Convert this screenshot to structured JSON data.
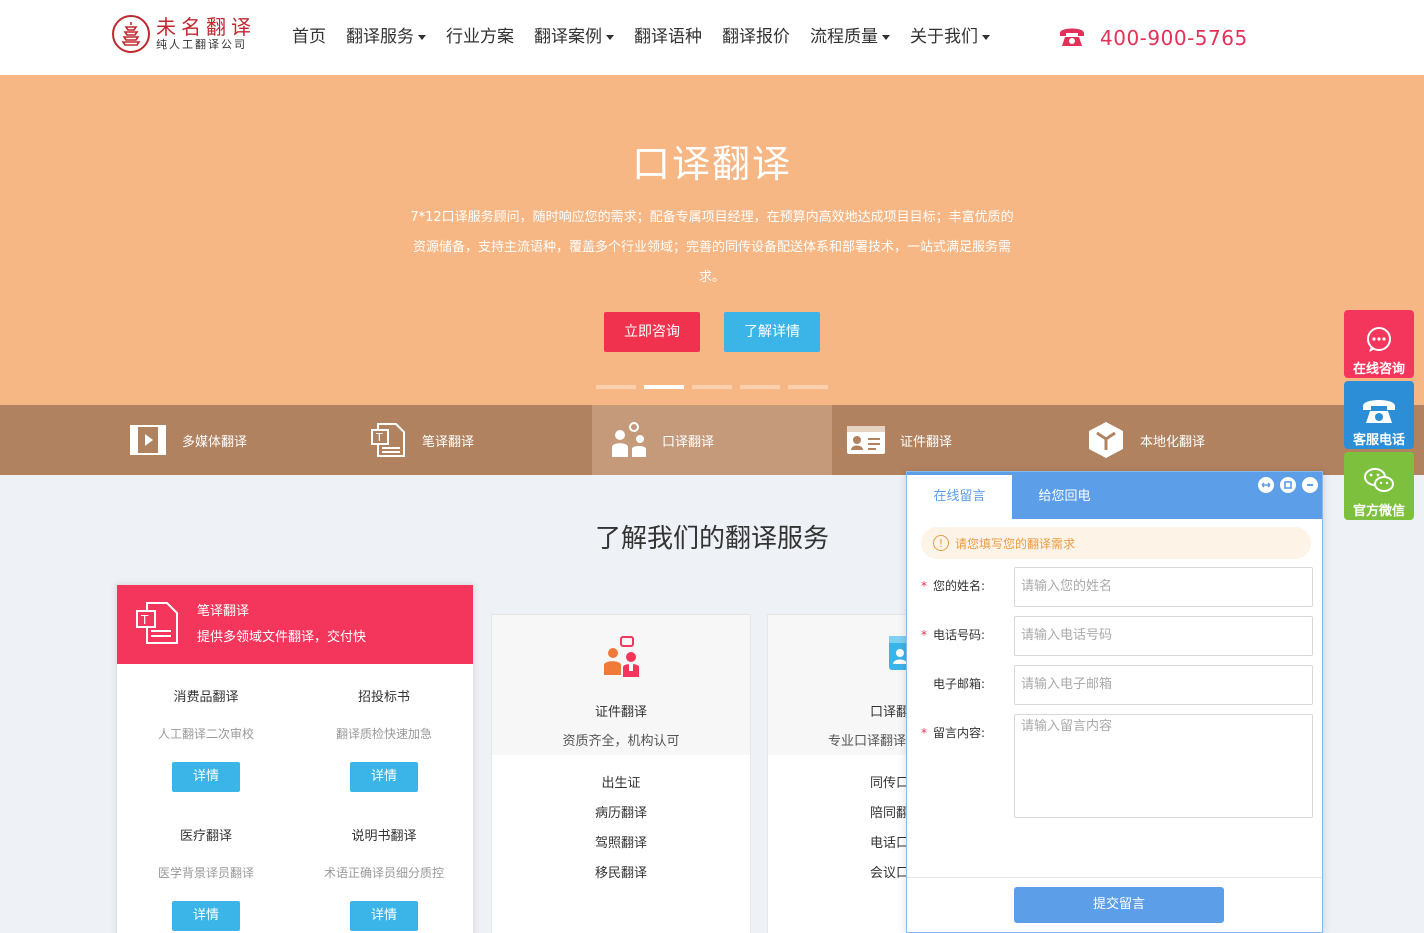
{
  "header": {
    "logo_title": "未名翻译",
    "logo_sub": "纯人工翻译公司",
    "nav": [
      {
        "label": "首页",
        "dropdown": false
      },
      {
        "label": "翻译服务",
        "dropdown": true
      },
      {
        "label": "行业方案",
        "dropdown": false
      },
      {
        "label": "翻译案例",
        "dropdown": true
      },
      {
        "label": "翻译语种",
        "dropdown": false
      },
      {
        "label": "翻译报价",
        "dropdown": false
      },
      {
        "label": "流程质量",
        "dropdown": true
      },
      {
        "label": "关于我们",
        "dropdown": true
      }
    ],
    "phone": "400-900-5765"
  },
  "banner": {
    "title": "口译翻译",
    "desc": "7*12口译服务顾问，随时响应您的需求；配备专属项目经理，在预算内高效地达成项目目标；丰富优质的资源储备，支持主流语种，覆盖多个行业领域；完善的同传设备配送体系和部署技术，一站式满足服务需求。",
    "btn_consult": "立即咨询",
    "btn_detail": "了解详情",
    "active_slide": 2,
    "slide_count": 5
  },
  "categories": [
    {
      "label": "多媒体翻译",
      "icon": "film-icon"
    },
    {
      "label": "笔译翻译",
      "icon": "document-icon"
    },
    {
      "label": "口译翻译",
      "icon": "people-icon",
      "active": true
    },
    {
      "label": "证件翻译",
      "icon": "id-card-icon"
    },
    {
      "label": "本地化翻译",
      "icon": "cube-icon"
    }
  ],
  "section_title": "了解我们的翻译服务",
  "card1": {
    "title": "笔译翻译",
    "sub": "提供多领域文件翻译，交付快",
    "items": [
      {
        "title": "消费品翻译",
        "desc": "人工翻译二次审校",
        "btn": "详情"
      },
      {
        "title": "招投标书",
        "desc": "翻译质检快速加急",
        "btn": "详情"
      },
      {
        "title": "医疗翻译",
        "desc": "医学背景译员翻译",
        "btn": "详情"
      },
      {
        "title": "说明书翻译",
        "desc": "术语正确译员细分质控",
        "btn": "详情"
      }
    ]
  },
  "card2": {
    "title": "证件翻译",
    "sub": "资质齐全，机构认可",
    "list": [
      "出生证",
      "病历翻译",
      "驾照翻译",
      "移民翻译"
    ]
  },
  "card3": {
    "title": "口译翻",
    "sub": "专业口译翻译",
    "list": [
      "同传口",
      "陪同翻",
      "电话口",
      "会议口"
    ]
  },
  "side": {
    "consult": "在线咨询",
    "phone": "客服电话",
    "wechat": "官方微信"
  },
  "chat": {
    "tab_message": "在线留言",
    "tab_callback": "给您回电",
    "notice": "请您填写您的翻译需求",
    "name_label": "您的姓名:",
    "name_placeholder": "请输入您的姓名",
    "phone_label": "电话号码:",
    "phone_placeholder": "请输入电话号码",
    "email_label": "电子邮箱:",
    "email_placeholder": "请输入电子邮箱",
    "content_label": "留言内容:",
    "content_placeholder": "请输入留言内容",
    "submit": "提交留言"
  },
  "colors": {
    "brand_red": "#c0282f",
    "accent_pink": "#f5365c",
    "accent_blue": "#3bb5e8",
    "banner_bg": "#f7b785",
    "catbar_bg": "#b0825f",
    "chat_blue": "#5c9ee8",
    "side_green": "#7cc03e"
  }
}
